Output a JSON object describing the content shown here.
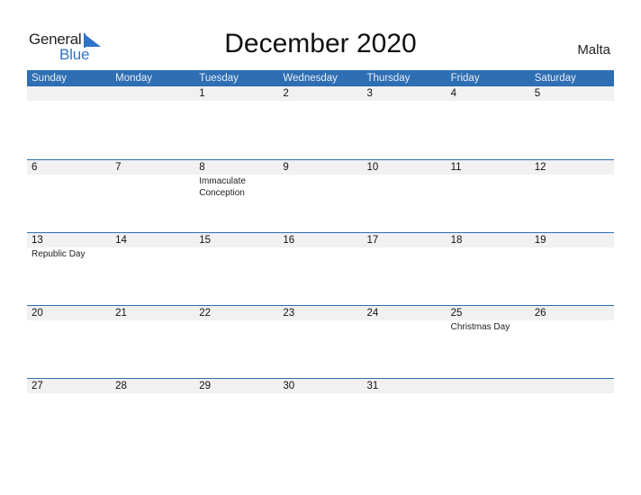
{
  "logo": {
    "line1": "General",
    "line2": "Blue"
  },
  "title": "December 2020",
  "country": "Malta",
  "weekdays": [
    "Sunday",
    "Monday",
    "Tuesday",
    "Wednesday",
    "Thursday",
    "Friday",
    "Saturday"
  ],
  "weeks": [
    {
      "dates": [
        "",
        "",
        "1",
        "2",
        "3",
        "4",
        "5"
      ],
      "events": [
        "",
        "",
        "",
        "",
        "",
        "",
        ""
      ]
    },
    {
      "dates": [
        "6",
        "7",
        "8",
        "9",
        "10",
        "11",
        "12"
      ],
      "events": [
        "",
        "",
        "Immaculate Conception",
        "",
        "",
        "",
        ""
      ]
    },
    {
      "dates": [
        "13",
        "14",
        "15",
        "16",
        "17",
        "18",
        "19"
      ],
      "events": [
        "Republic Day",
        "",
        "",
        "",
        "",
        "",
        ""
      ]
    },
    {
      "dates": [
        "20",
        "21",
        "22",
        "23",
        "24",
        "25",
        "26"
      ],
      "events": [
        "",
        "",
        "",
        "",
        "",
        "Christmas Day",
        ""
      ]
    },
    {
      "dates": [
        "27",
        "28",
        "29",
        "30",
        "31",
        "",
        ""
      ],
      "events": [
        "",
        "",
        "",
        "",
        "",
        "",
        ""
      ]
    }
  ],
  "colors": {
    "header": "#2E6EB3",
    "brand_blue": "#2E75C8",
    "date_band": "#f1f1f1"
  }
}
